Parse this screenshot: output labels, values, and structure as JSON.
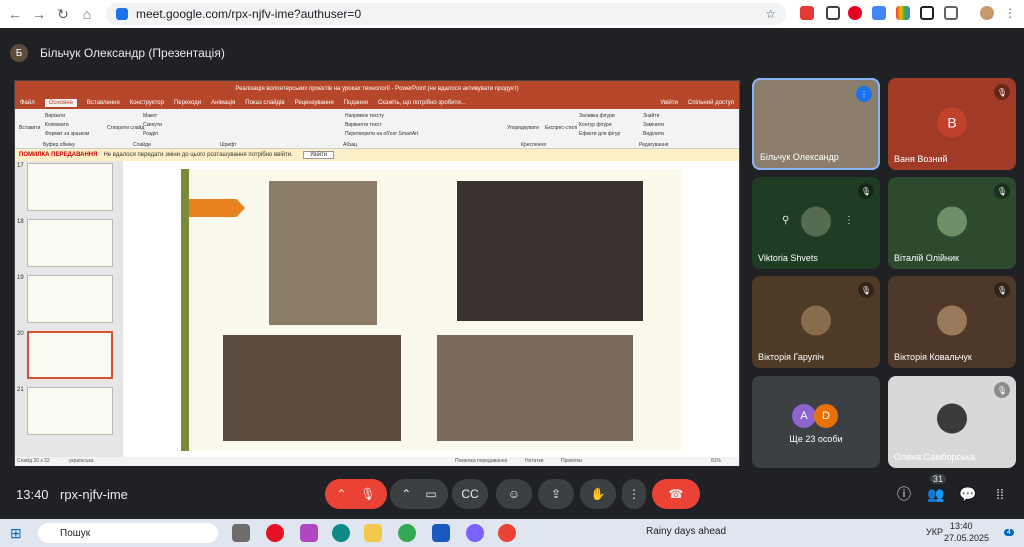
{
  "browser": {
    "url": "meet.google.com/rpx-njfv-ime?authuser=0"
  },
  "meet": {
    "presenter_initial": "Б",
    "presenter_title": "Більчук Олександр (Презентація)",
    "time": "13:40",
    "code": "rpx-njfv-ime",
    "people_count": "31"
  },
  "ppt": {
    "title": "Реалізація волонтерських проєктів на уроках технології - PowerPoint (не вдалося активувати продукт)",
    "tabs": [
      "Файл",
      "Основне",
      "Вставлення",
      "Конструктор",
      "Переходи",
      "Анімація",
      "Показ слайдів",
      "Рецензування",
      "Подання",
      "Скажіть, що потрібно зробити..."
    ],
    "signin": "Увійти",
    "share": "Спільний доступ",
    "ribbon_items": [
      "Вставити",
      "Вирізати",
      "Копіювати",
      "Формат за зразком",
      "Буфер обміну",
      "Створити слайд",
      "Макет",
      "Скинути",
      "Розділ",
      "Слайди",
      "Шрифт",
      "Абзац",
      "Напрямок тексту",
      "Вирівняти текст",
      "Перетворити на об'єкт SmartArt",
      "Упорядкувати",
      "Експрес-стилі",
      "Заливка фігури",
      "Контур фігури",
      "Ефекти для фігур",
      "Креслення",
      "Знайти",
      "Замінити",
      "Виділити",
      "Редагування"
    ],
    "warn_title": "ПОМИЛКА ПЕРЕДАВАННЯ",
    "warn_text": "Не вдалося передати зміни до цього розташування потрібно ввійти.",
    "warn_button": "Увійти",
    "thumb_numbers": [
      "17",
      "18",
      "19",
      "20",
      "21"
    ],
    "status": {
      "slide": "Слайд 20 з 32",
      "lang": "українська",
      "upload": "Помилка передавання",
      "notes": "Нотатки",
      "comments": "Примітки",
      "zoom": "81%"
    }
  },
  "tiles": [
    {
      "name": "Більчук Олександр"
    },
    {
      "name": "Ваня Возний",
      "initial": "В"
    },
    {
      "name": "Viktoria Shvets"
    },
    {
      "name": "Віталій Олійник"
    },
    {
      "name": "Вікторія Гаруліч"
    },
    {
      "name": "Вікторія Ковальчук"
    },
    {
      "name": "Ще 23 особи",
      "a1": "A",
      "a2": "D"
    },
    {
      "name": "Олена Самборська"
    }
  ],
  "taskbar": {
    "search": "Пошук",
    "weather": "Rainy days ahead",
    "lang": "УКР",
    "time": "13:40",
    "date": "27.05.2025",
    "badge": "4"
  },
  "colors": {
    "meet_bg": "#202124",
    "ppt_red": "#b7472a",
    "end_call": "#ea4335"
  }
}
